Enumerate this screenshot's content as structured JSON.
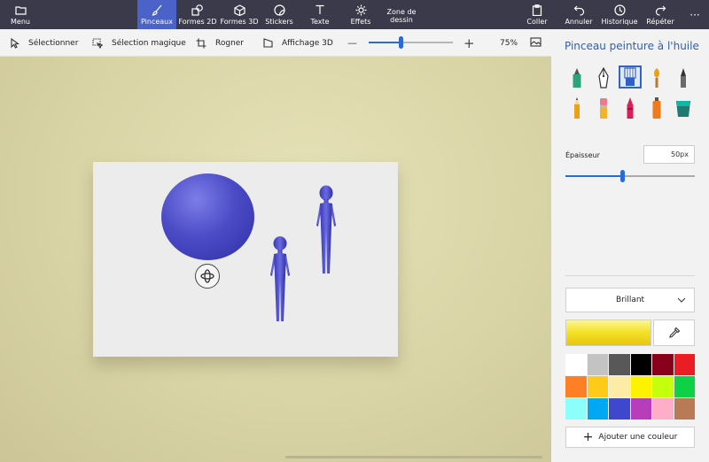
{
  "topbar": {
    "menu_label": "Menu",
    "tools": [
      {
        "label": "Pinceaux",
        "icon": "brush-icon",
        "active": true
      },
      {
        "label": "Formes 2D",
        "icon": "shapes-2d-icon"
      },
      {
        "label": "Formes 3D",
        "icon": "cube-icon"
      },
      {
        "label": "Stickers",
        "icon": "sticker-icon"
      },
      {
        "label": "Texte",
        "icon": "text-icon"
      },
      {
        "label": "Effets",
        "icon": "sun-icon"
      }
    ],
    "zone_label_line1": "Zone de",
    "zone_label_line2": "dessin",
    "right_actions": [
      {
        "label": "Coller",
        "icon": "clipboard-icon"
      },
      {
        "label": "Annuler",
        "icon": "undo-icon"
      },
      {
        "label": "Historique",
        "icon": "history-icon"
      },
      {
        "label": "Répéter",
        "icon": "redo-icon"
      }
    ],
    "more_label": "···"
  },
  "toolbar": {
    "select_label": "Sélectionner",
    "magic_select_label": "Sélection magique",
    "crop_label": "Rogner",
    "view3d_label": "Affichage 3D",
    "zoom_minus": "—",
    "zoom_plus": "+",
    "zoom_percent": "75%",
    "zoom_slider_fraction": 0.38
  },
  "panel": {
    "title": "Pinceau peinture à l'huile",
    "brushes": [
      {
        "name": "marker-icon",
        "color": "#2aa37a"
      },
      {
        "name": "calligraphy-pen-icon",
        "color": "#3a3a3a"
      },
      {
        "name": "oil-brush-icon",
        "color": "#2f5fc8",
        "selected": true
      },
      {
        "name": "watercolor-icon",
        "color": "#e7a21a"
      },
      {
        "name": "pixel-pen-icon",
        "color": "#4a4a4a"
      },
      {
        "name": "pencil-icon",
        "color": "#e7a21a"
      },
      {
        "name": "eraser-icon",
        "color": "#f07a8c"
      },
      {
        "name": "crayon-icon",
        "color": "#d81e5b"
      },
      {
        "name": "spray-can-icon",
        "color": "#f07b1e"
      },
      {
        "name": "fill-bucket-icon",
        "color": "#1f7b70"
      }
    ],
    "thickness_label": "Épaisseur",
    "thickness_value": "50px",
    "thickness_fraction": 0.44,
    "finish_label": "Brillant",
    "current_color": "#f4e32a",
    "palette": [
      "#ffffff",
      "#c3c3c3",
      "#585858",
      "#000000",
      "#88001b",
      "#ec1c24",
      "#ff7f27",
      "#ffca18",
      "#fdeca6",
      "#fff200",
      "#c4ff0e",
      "#0ed145",
      "#8cfffb",
      "#00a8f3",
      "#3f48cc",
      "#b83dba",
      "#ffaec8",
      "#b97a56"
    ],
    "add_color_label": "Ajouter une couleur"
  },
  "colors": {
    "accent": "#2b6ad0",
    "topbar_bg": "#3b3a4a",
    "active_tab_bg": "#4b63c8",
    "object_blue": "#4c4cc7"
  }
}
